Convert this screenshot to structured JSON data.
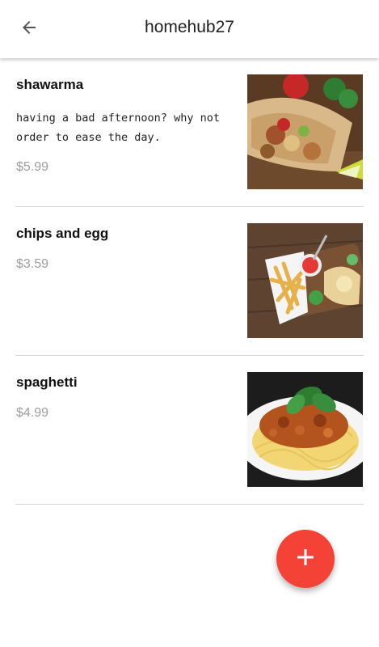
{
  "appbar": {
    "title": "homehub27",
    "back_icon": "arrow-back-icon"
  },
  "menu_items": [
    {
      "name": "shawarma",
      "description": "having a bad afternoon? why not order to ease the day.",
      "price": "$5.99",
      "image_icon": "shawarma-photo"
    },
    {
      "name": "chips and egg",
      "description": "",
      "price": "$3.59",
      "image_icon": "chips-and-egg-photo"
    },
    {
      "name": "spaghetti",
      "description": "",
      "price": "$4.99",
      "image_icon": "spaghetti-photo"
    }
  ],
  "fab": {
    "icon": "plus-icon",
    "color": "#f44336"
  },
  "colors": {
    "accent": "#f44336",
    "price_text": "#9e9e9e",
    "divider": "#d6d6d6"
  }
}
